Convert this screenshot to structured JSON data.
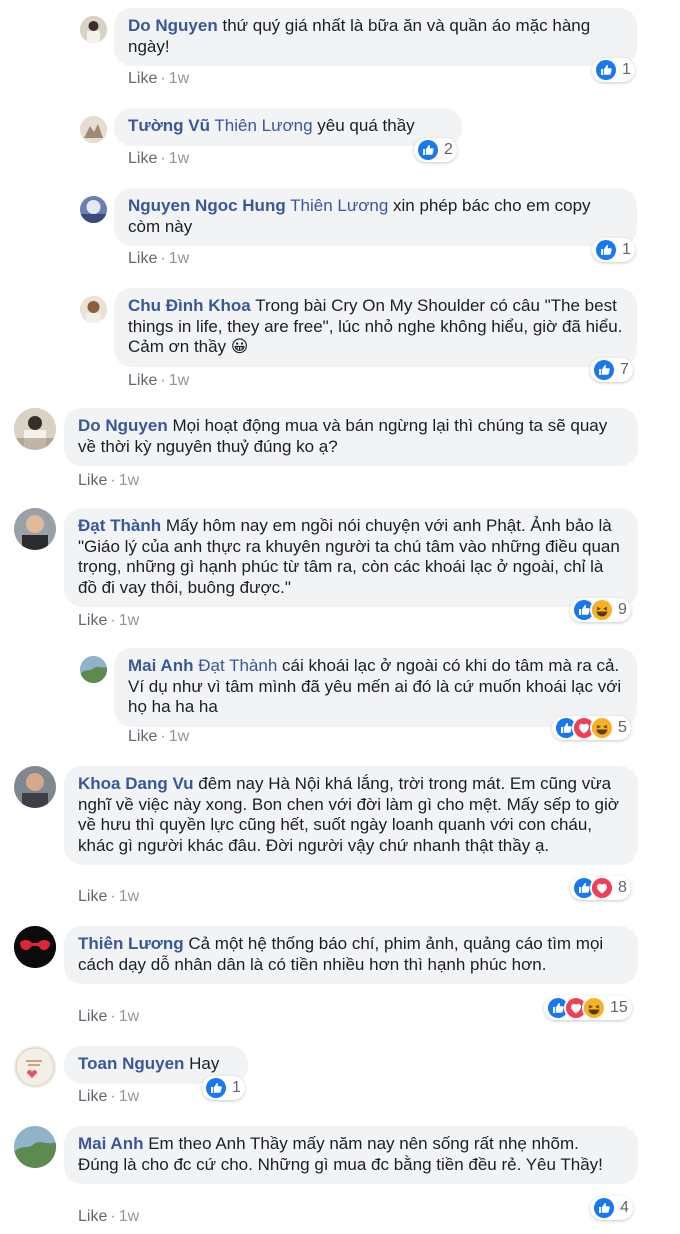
{
  "comments": [
    {
      "author": "Do Nguyen",
      "tag": "",
      "text": "thứ quý giá nhất là bữa ăn và quần áo mặc hàng ngày!",
      "like": "Like",
      "time": "1w",
      "reactions": [
        "like"
      ],
      "count": "1"
    },
    {
      "author": "Tường Vũ",
      "tag": "Thiên Lương",
      "text": "yêu quá thầy",
      "like": "Like",
      "time": "1w",
      "reactions": [
        "like"
      ],
      "count": "2"
    },
    {
      "author": "Nguyen Ngoc Hung",
      "tag": "Thiên Lương",
      "text": "xin phép bác cho em copy còm này",
      "like": "Like",
      "time": "1w",
      "reactions": [
        "like"
      ],
      "count": "1"
    },
    {
      "author": "Chu Đình Khoa",
      "tag": "",
      "text": "Trong bài Cry On My Shoulder có câu \"The best things in life, they are free\", lúc nhỏ nghe không hiểu, giờ đã hiểu. Cảm ơn thầy 😀",
      "like": "Like",
      "time": "1w",
      "reactions": [
        "like"
      ],
      "count": "7"
    },
    {
      "author": "Do Nguyen",
      "tag": "",
      "text": "Mọi hoạt động mua và bán ngừng lại thì chúng ta sẽ quay về thời kỳ nguyên thuỷ đúng ko ạ?",
      "like": "Like",
      "time": "1w",
      "reactions": [],
      "count": ""
    },
    {
      "author": "Đạt Thành",
      "tag": "",
      "text": "Mấy hôm nay em ngồi nói chuyện với anh Phật. Ảnh bảo là \"Giáo lý của anh thực ra khuyên người ta chú tâm vào những điều quan trọng, những gì hạnh phúc từ tâm ra, còn các khoái lạc ở ngoài, chỉ là đồ đi vay thôi, buông được.\"",
      "like": "Like",
      "time": "1w",
      "reactions": [
        "like",
        "haha"
      ],
      "count": "9"
    },
    {
      "author": "Mai Anh",
      "tag": "Đạt Thành",
      "text": "cái khoái lạc ở ngoài có khi do tâm mà ra cả. Ví dụ như vì tâm mình đã yêu mến ai đó là cứ muốn khoái lạc với họ ha ha ha",
      "like": "Like",
      "time": "1w",
      "reactions": [
        "like",
        "love",
        "haha"
      ],
      "count": "5"
    },
    {
      "author": "Khoa Dang Vu",
      "tag": "",
      "text": "đêm nay Hà Nội khá lắng, trời trong mát. Em cũng vừa nghĩ về việc này xong. Bon chen với đời làm gì cho mệt. Mấy sếp to giờ về hưu thì quyền lực cũng hết, suốt ngày loanh quanh với con cháu, khác gì người khác đâu. Đời người vậy chứ nhanh thật thầy ạ.",
      "like": "Like",
      "time": "1w",
      "reactions": [
        "like",
        "love"
      ],
      "count": "8"
    },
    {
      "author": "Thiên Lương",
      "tag": "",
      "text": "Cả một hệ thống báo chí, phim ảnh, quảng cáo tìm mọi cách dạy dỗ nhân dân là có tiền nhiều hơn thì hạnh phúc hơn.",
      "like": "Like",
      "time": "1w",
      "reactions": [
        "like",
        "love",
        "haha"
      ],
      "count": "15"
    },
    {
      "author": "Toan Nguyen",
      "tag": "",
      "text": "Hay",
      "like": "Like",
      "time": "1w",
      "reactions": [
        "like"
      ],
      "count": "1"
    },
    {
      "author": "Mai Anh",
      "tag": "",
      "text": "Em theo Anh Thầy mấy năm nay nên sống rất nhẹ nhõm. Đúng là cho đc cứ cho. Những gì mua đc bằng tiền đều rẻ. Yêu Thầy!",
      "like": "Like",
      "time": "1w",
      "reactions": [
        "like"
      ],
      "count": "4"
    }
  ],
  "colors": {
    "link": "#385898",
    "bubble": "#f2f3f5",
    "meta": "#90949c",
    "like": "#1877f2",
    "love": "#f33e58",
    "haha": "#f7b125"
  }
}
